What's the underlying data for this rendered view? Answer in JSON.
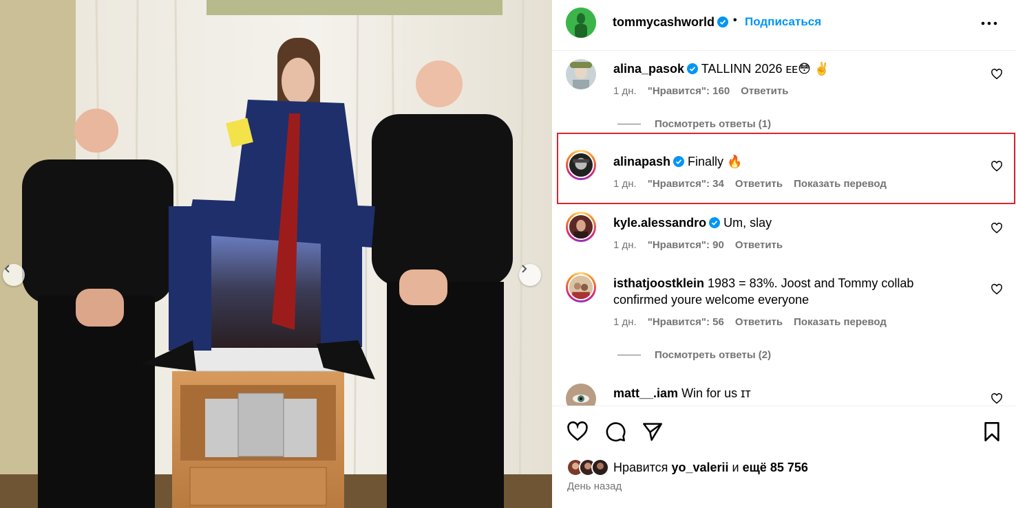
{
  "post": {
    "author": "tommycashworld",
    "follow_label": "Подписаться",
    "dot": "•"
  },
  "comments": [
    {
      "user": "alina_pasok",
      "text": "TALLINN 2026 ᴇᴇ😳 ✌️",
      "time": "1 дн.",
      "likes": "\"Нравится\": 160",
      "reply": "Ответить",
      "translate": "",
      "view_replies": "Посмотреть ответы (1)"
    },
    {
      "user": "alinapash",
      "text": "Finally 🔥",
      "time": "1 дн.",
      "likes": "\"Нравится\": 34",
      "reply": "Ответить",
      "translate": "Показать перевод"
    },
    {
      "user": "kyle.alessandro",
      "text": "Um, slay",
      "time": "1 дн.",
      "likes": "\"Нравится\": 90",
      "reply": "Ответить"
    },
    {
      "user": "isthatjoostklein",
      "text": "1983 = 83%. Joost and Tommy collab confirmed youre welcome everyone",
      "time": "1 дн.",
      "likes": "\"Нравится\": 56",
      "reply": "Ответить",
      "translate": "Показать перевод",
      "view_replies": "Посмотреть ответы (2)"
    },
    {
      "user": "matt__.iam",
      "text": "Win for us ɪᴛ"
    }
  ],
  "likes": {
    "prefix": "Нравится",
    "user": "yo_valerii",
    "joiner": "и",
    "count": "ещё 85 756"
  },
  "date": "День назад",
  "colors": {
    "accent": "#0095f6",
    "verified": "#0095f6",
    "highlight": "#e0232c",
    "muted": "#737373"
  }
}
